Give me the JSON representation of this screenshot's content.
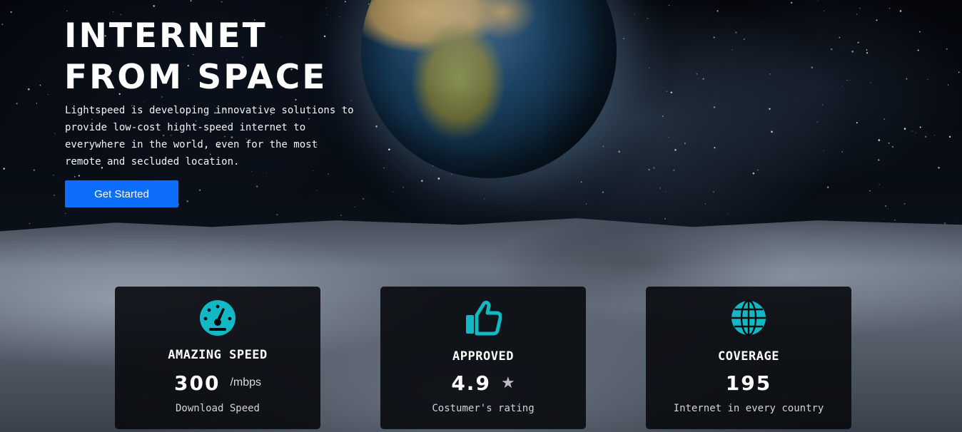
{
  "hero": {
    "title": "INTERNET\nFROM SPACE",
    "description": "Lightspeed is developing innovative solutions to provide low-cost hight-speed internet to everywhere in the world, even for the most remote and secluded location.",
    "cta_label": "Get Started"
  },
  "stats": [
    {
      "icon": "speedometer-icon",
      "title": "AMAZING SPEED",
      "value": "300",
      "unit": "/mbps",
      "subtitle": "Download Speed"
    },
    {
      "icon": "thumbs-up-icon",
      "title": "APPROVED",
      "value": "4.9",
      "unit": "★",
      "subtitle": "Costumer's rating"
    },
    {
      "icon": "globe-icon",
      "title": "COVERAGE",
      "value": "195",
      "unit": "",
      "subtitle": "Internet in every country"
    }
  ],
  "colors": {
    "accent_icon": "#12b8c4",
    "button": "#0d6efd",
    "card_bg": "#08090c"
  }
}
